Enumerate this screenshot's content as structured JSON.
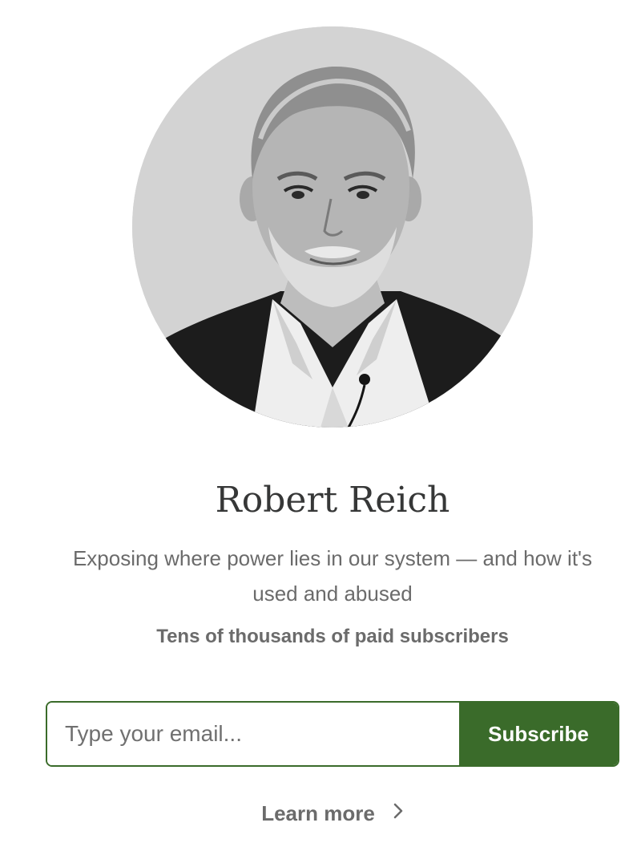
{
  "publication": {
    "title": "Robert Reich",
    "description": "Exposing where power lies in our system — and how it's used and abused",
    "subscriber_count": "Tens of thousands of paid subscribers"
  },
  "subscribe": {
    "email_placeholder": "Type your email...",
    "email_value": "",
    "button_label": "Subscribe"
  },
  "learn_more": {
    "label": "Learn more",
    "icon": "chevron-right-icon"
  },
  "colors": {
    "accent": "#3a6b2a",
    "title_text": "#363737",
    "muted_text": "#6b6b6b",
    "avatar_background": "#d3d3d3"
  }
}
